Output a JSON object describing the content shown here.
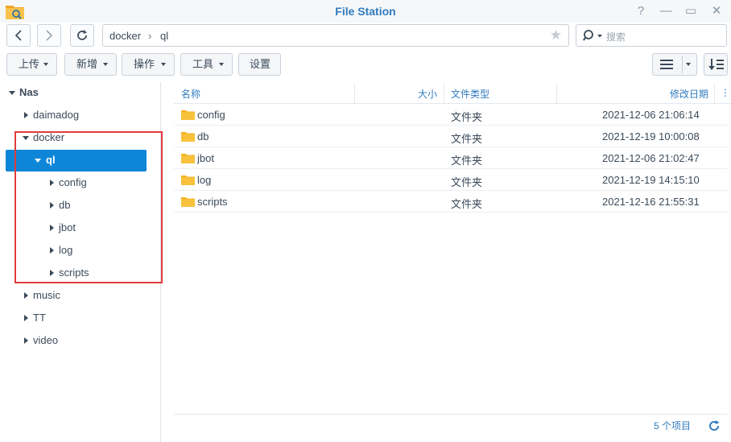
{
  "window": {
    "title": "File Station",
    "help_glyph": "?",
    "minimize_glyph": "—",
    "maximize_glyph": "▭",
    "close_glyph": "✕"
  },
  "nav": {
    "back_icon": "chevron-left-icon",
    "forward_icon": "chevron-right-icon",
    "refresh_icon": "refresh-icon"
  },
  "path": {
    "segments": [
      "docker",
      "ql"
    ],
    "separator": "›"
  },
  "search": {
    "placeholder": "搜索"
  },
  "toolbar": {
    "upload": "上传",
    "create": "新增",
    "action": "操作",
    "tools": "工具",
    "settings": "设置"
  },
  "tree": {
    "root": "Nas",
    "items": [
      {
        "label": "daimadog"
      },
      {
        "label": "docker"
      },
      {
        "label": "ql"
      },
      {
        "label": "config"
      },
      {
        "label": "db"
      },
      {
        "label": "jbot"
      },
      {
        "label": "log"
      },
      {
        "label": "scripts"
      },
      {
        "label": "music"
      },
      {
        "label": "TT"
      },
      {
        "label": "video"
      }
    ]
  },
  "list": {
    "columns": {
      "name": "名称",
      "size": "大小",
      "type": "文件类型",
      "modified": "修改日期",
      "more": "⋮"
    },
    "rows": [
      {
        "name": "config",
        "type": "文件夹",
        "modified": "2021-12-06 21:06:14"
      },
      {
        "name": "db",
        "type": "文件夹",
        "modified": "2021-12-19 10:00:08"
      },
      {
        "name": "jbot",
        "type": "文件夹",
        "modified": "2021-12-06 21:02:47"
      },
      {
        "name": "log",
        "type": "文件夹",
        "modified": "2021-12-19 14:15:10"
      },
      {
        "name": "scripts",
        "type": "文件夹",
        "modified": "2021-12-16 21:55:31"
      }
    ]
  },
  "status": {
    "item_count": "5 个项目"
  },
  "colors": {
    "accent": "#0d86d8",
    "highlight_box": "#e03c3c",
    "folder": "#f5b323"
  }
}
